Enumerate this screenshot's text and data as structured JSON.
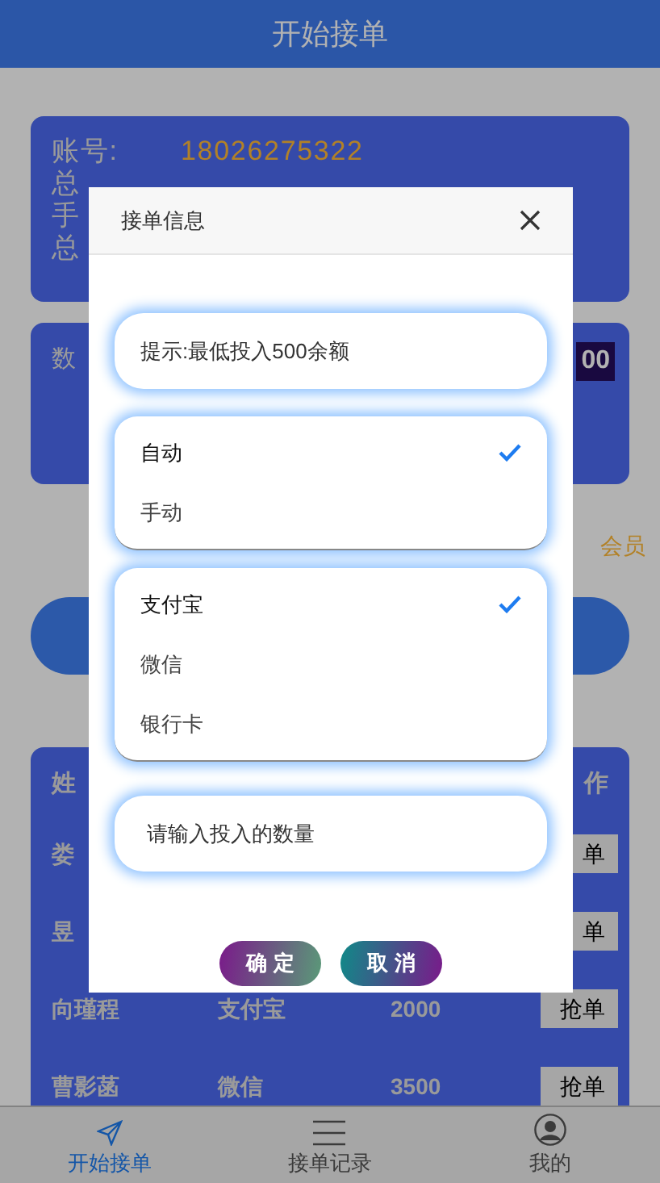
{
  "header": {
    "title": "开始接单"
  },
  "account": {
    "label": "账号:",
    "value": "18026275322"
  },
  "account_labels": [
    "总",
    "手",
    "总"
  ],
  "quantity": {
    "label": "数",
    "badge": "00"
  },
  "notice": "会员",
  "table": {
    "columns": [
      "姓",
      "作"
    ],
    "rows": [
      {
        "name": "娄",
        "method": "",
        "amount": "",
        "action": "单"
      },
      {
        "name": "昱",
        "method": "",
        "amount": "",
        "action": "单"
      },
      {
        "name": "向瑾程",
        "method": "支付宝",
        "amount": "2000",
        "action": "抢单"
      },
      {
        "name": "曹影菡",
        "method": "微信",
        "amount": "3500",
        "action": "抢单"
      }
    ]
  },
  "nav": [
    {
      "label": "开始接单",
      "selected": true
    },
    {
      "label": "接单记录",
      "selected": false
    },
    {
      "label": "我的",
      "selected": false
    }
  ],
  "dialog": {
    "title": "接单信息",
    "hint": "提示:最低投入500余额",
    "modes": [
      {
        "label": "自动",
        "selected": true
      },
      {
        "label": "手动",
        "selected": false
      }
    ],
    "methods": [
      {
        "label": "支付宝",
        "selected": true
      },
      {
        "label": "微信",
        "selected": false
      },
      {
        "label": "银行卡",
        "selected": false
      }
    ],
    "amount_placeholder": "请输入投入的数量",
    "buttons": [
      {
        "label": "确 定",
        "kind": "confirm"
      },
      {
        "label": "取 消",
        "kind": "cancel"
      }
    ]
  }
}
